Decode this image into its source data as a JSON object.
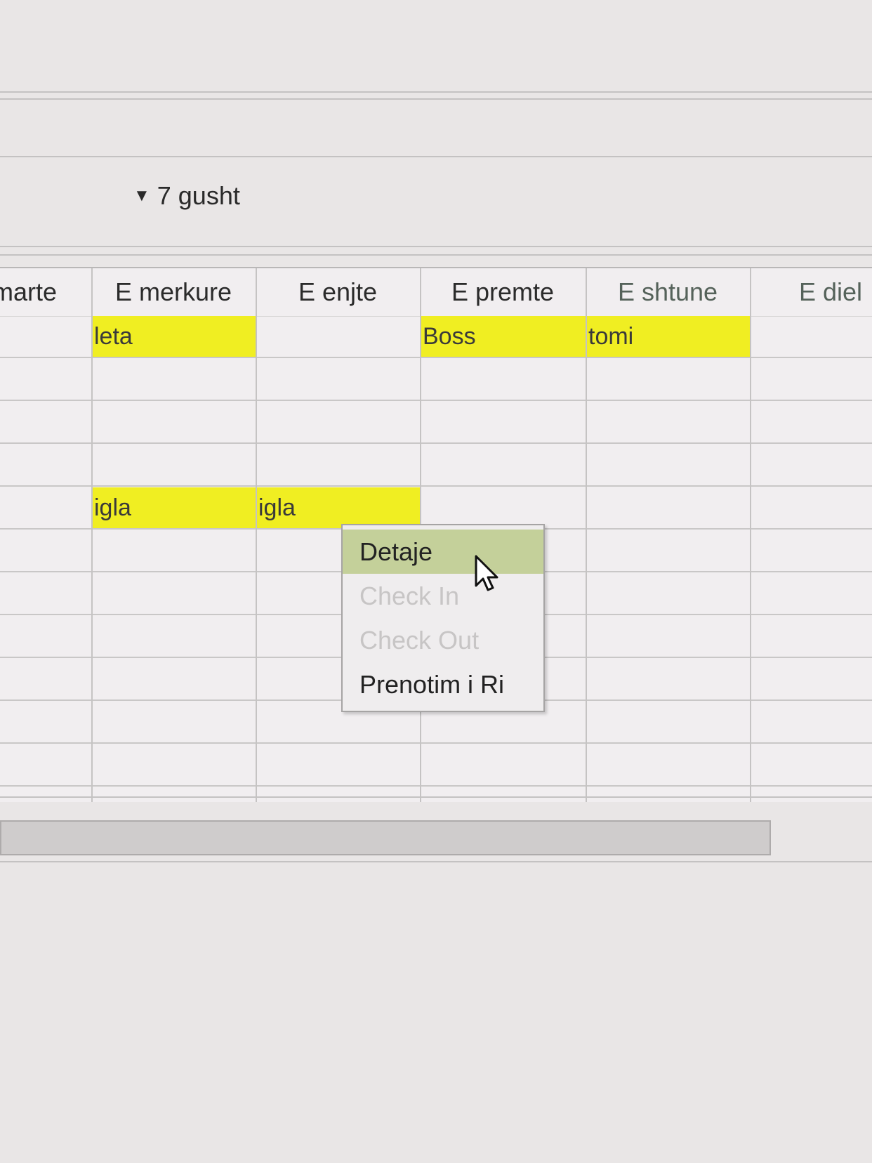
{
  "date_selector": {
    "arrow": "▼",
    "label": "7 gusht"
  },
  "calendar": {
    "columns": [
      {
        "label": "marte",
        "weekend": false,
        "cells": [
          "",
          "",
          "",
          "",
          "",
          "",
          "",
          "",
          "",
          "",
          ""
        ]
      },
      {
        "label": "E merkure",
        "weekend": false,
        "cells": [
          "leta",
          "",
          "",
          "",
          "igla",
          "",
          "",
          "",
          "",
          "",
          ""
        ]
      },
      {
        "label": "E enjte",
        "weekend": false,
        "cells": [
          "",
          "",
          "",
          "",
          "igla",
          "",
          "",
          "",
          "",
          "",
          ""
        ]
      },
      {
        "label": "E premte",
        "weekend": false,
        "cells": [
          "Boss",
          "",
          "",
          "",
          "",
          "",
          "",
          "",
          "",
          "",
          ""
        ]
      },
      {
        "label": "E shtune",
        "weekend": true,
        "cells": [
          "tomi",
          "",
          "",
          "",
          "",
          "",
          "",
          "",
          "",
          "",
          ""
        ]
      },
      {
        "label": "E diel",
        "weekend": true,
        "cells": [
          "",
          "",
          "",
          "",
          "",
          "",
          "",
          "",
          "",
          "",
          ""
        ]
      }
    ],
    "booking_color": "#f0ee22"
  },
  "context_menu": {
    "items": [
      {
        "label": "Detaje",
        "enabled": true,
        "selected": true
      },
      {
        "label": "Check In",
        "enabled": false,
        "selected": false
      },
      {
        "label": "Check Out",
        "enabled": false,
        "selected": false
      },
      {
        "label": "Prenotim i Ri",
        "enabled": true,
        "selected": false
      }
    ],
    "highlight_color": "#c4d09a"
  }
}
